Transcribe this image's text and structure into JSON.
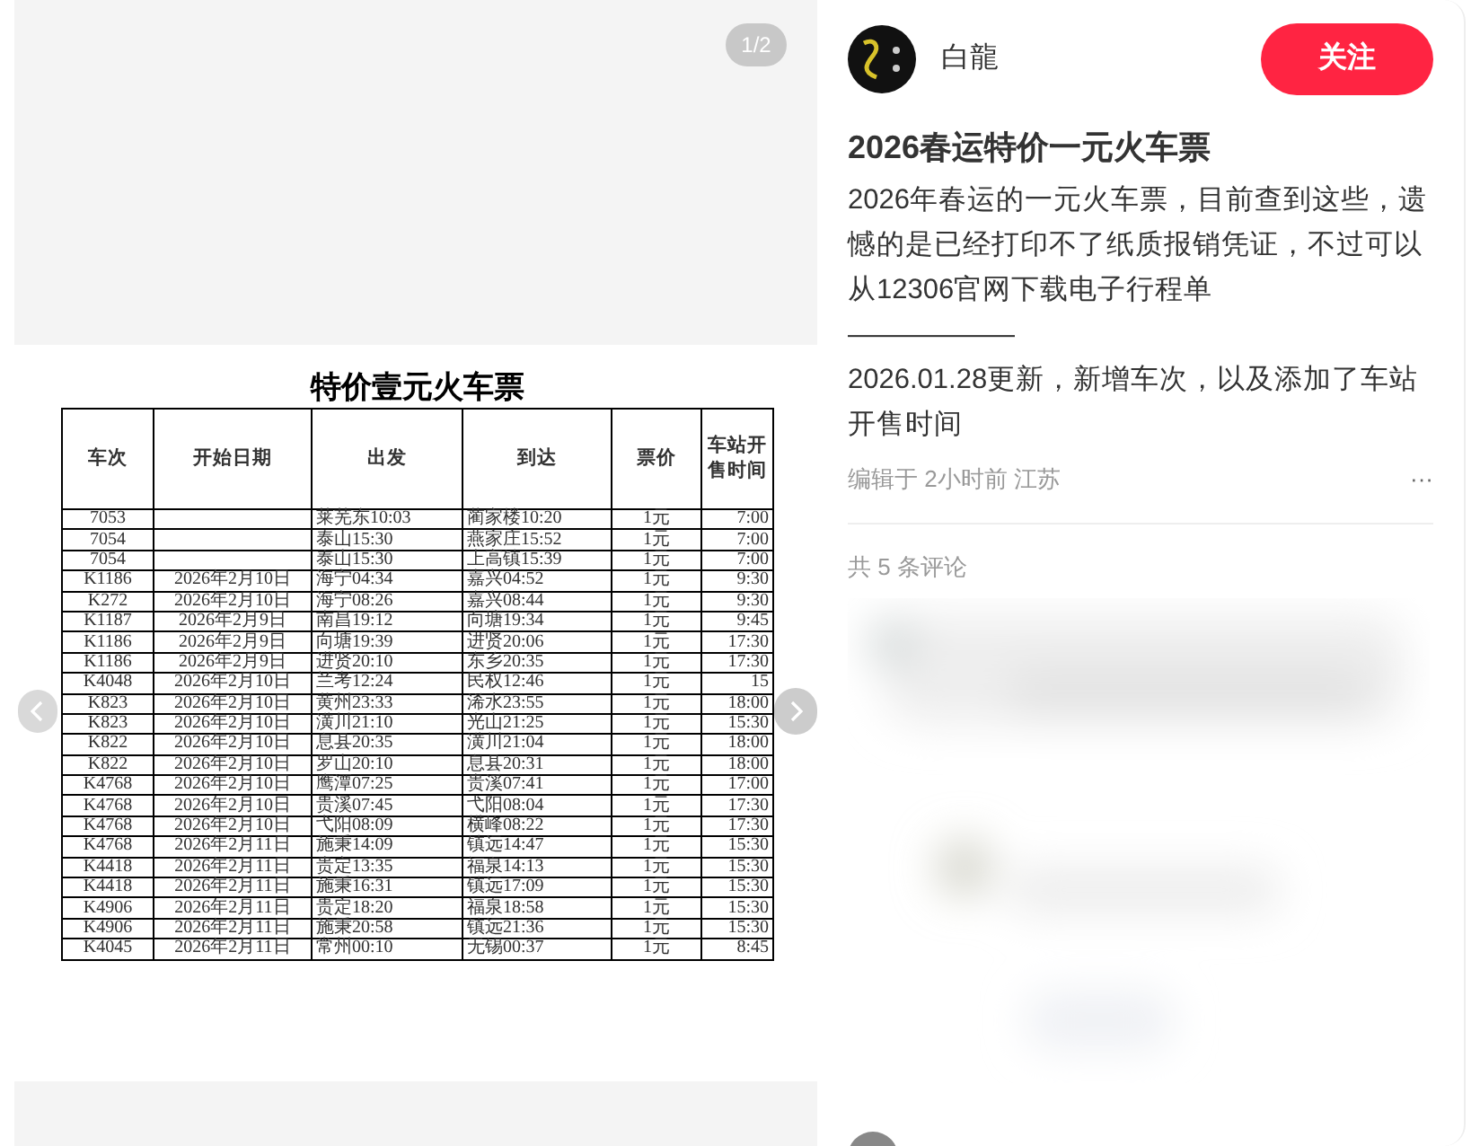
{
  "image_viewer": {
    "counter": "1/2",
    "document": {
      "title": "特价壹元火车票",
      "columns": [
        "车次",
        "开始日期",
        "出发",
        "到达",
        "票价",
        "车站开售时间"
      ],
      "rows": [
        {
          "train": "7053",
          "depart": "莱芜东10:03",
          "arrive": "蔺家楼10:20",
          "price": "1元",
          "sale_time": "7:00"
        },
        {
          "train": "7054",
          "depart": "泰山15:30",
          "arrive": "燕家庄15:52",
          "price": "1元",
          "sale_time": "7:00"
        },
        {
          "train": "7054",
          "depart": "泰山15:30",
          "arrive": "上高镇15:39",
          "price": "1元",
          "sale_time": "7:00"
        },
        {
          "train": "K1186",
          "date": "2026年2月10日",
          "depart": "海宁04:34",
          "arrive": "嘉兴04:52",
          "price": "1元",
          "sale_time": "9:30"
        },
        {
          "train": "K272",
          "date": "2026年2月10日",
          "depart": "海宁08:26",
          "arrive": "嘉兴08:44",
          "price": "1元",
          "sale_time": "9:30"
        },
        {
          "train": "K1187",
          "date": "2026年2月9日",
          "depart": "南昌19:12",
          "arrive": "向塘19:34",
          "price": "1元",
          "sale_time": "9:45"
        },
        {
          "train": "K1186",
          "date": "2026年2月9日",
          "depart": "向塘19:39",
          "arrive": "进贤20:06",
          "price": "1元",
          "sale_time": "17:30"
        },
        {
          "train": "K1186",
          "date": "2026年2月9日",
          "depart": "进贤20:10",
          "arrive": "东乡20:35",
          "price": "1元",
          "sale_time": "17:30"
        },
        {
          "train": "K4048",
          "date": "2026年2月10日",
          "depart": "兰考12:24",
          "arrive": "民权12:46",
          "price": "1元",
          "sale_time": "15"
        },
        {
          "train": "K823",
          "date": "2026年2月10日",
          "depart": "黄州23:33",
          "arrive": "浠水23:55",
          "price": "1元",
          "sale_time": "18:00"
        },
        {
          "train": "K823",
          "date": "2026年2月10日",
          "depart": "潢川21:10",
          "arrive": "光山21:25",
          "price": "1元",
          "sale_time": "15:30"
        },
        {
          "train": "K822",
          "date": "2026年2月10日",
          "depart": "息县20:35",
          "arrive": "潢川21:04",
          "price": "1元",
          "sale_time": "18:00"
        },
        {
          "train": "K822",
          "date": "2026年2月10日",
          "depart": "罗山20:10",
          "arrive": "息县20:31",
          "price": "1元",
          "sale_time": "18:00"
        },
        {
          "train": "K4768",
          "date": "2026年2月10日",
          "depart": "鹰潭07:25",
          "arrive": "贵溪07:41",
          "price": "1元",
          "sale_time": "17:00"
        },
        {
          "train": "K4768",
          "date": "2026年2月10日",
          "depart": "贵溪07:45",
          "arrive": "弋阳08:04",
          "price": "1元",
          "sale_time": "17:30"
        },
        {
          "train": "K4768",
          "date": "2026年2月10日",
          "depart": "弋阳08:09",
          "arrive": "横峰08:22",
          "price": "1元",
          "sale_time": "17:30"
        },
        {
          "train": "K4768",
          "date": "2026年2月11日",
          "depart": "施秉14:09",
          "arrive": "镇远14:47",
          "price": "1元",
          "sale_time": "15:30"
        },
        {
          "train": "K4418",
          "date": "2026年2月11日",
          "depart": "贵定13:35",
          "arrive": "福泉14:13",
          "price": "1元",
          "sale_time": "15:30"
        },
        {
          "train": "K4418",
          "date": "2026年2月11日",
          "depart": "施秉16:31",
          "arrive": "镇远17:09",
          "price": "1元",
          "sale_time": "15:30"
        },
        {
          "train": "K4906",
          "date": "2026年2月11日",
          "depart": "贵定18:20",
          "arrive": "福泉18:58",
          "price": "1元",
          "sale_time": "15:30"
        },
        {
          "train": "K4906",
          "date": "2026年2月11日",
          "depart": "施秉20:58",
          "arrive": "镇远21:36",
          "price": "1元",
          "sale_time": "15:30"
        },
        {
          "train": "K4045",
          "date": "2026年2月11日",
          "depart": "常州00:10",
          "arrive": "无锡00:37",
          "price": "1元",
          "sale_time": "8:45"
        }
      ]
    }
  },
  "post": {
    "author": "白龍",
    "follow_button": "关注",
    "title": "2026春运特价一元火车票",
    "paragraphs": [
      "2026年春运的一元火车票，目前查到这些，遗憾的是已经打印不了纸质报销凭证，不过可以从12306官网下载电子行程单",
      "——————",
      "2026.01.28更新，新增车次，以及添加了车站开售时间"
    ],
    "meta": "编辑于 2小时前 江苏",
    "more": "···",
    "comment_count": "共 5 条评论"
  }
}
